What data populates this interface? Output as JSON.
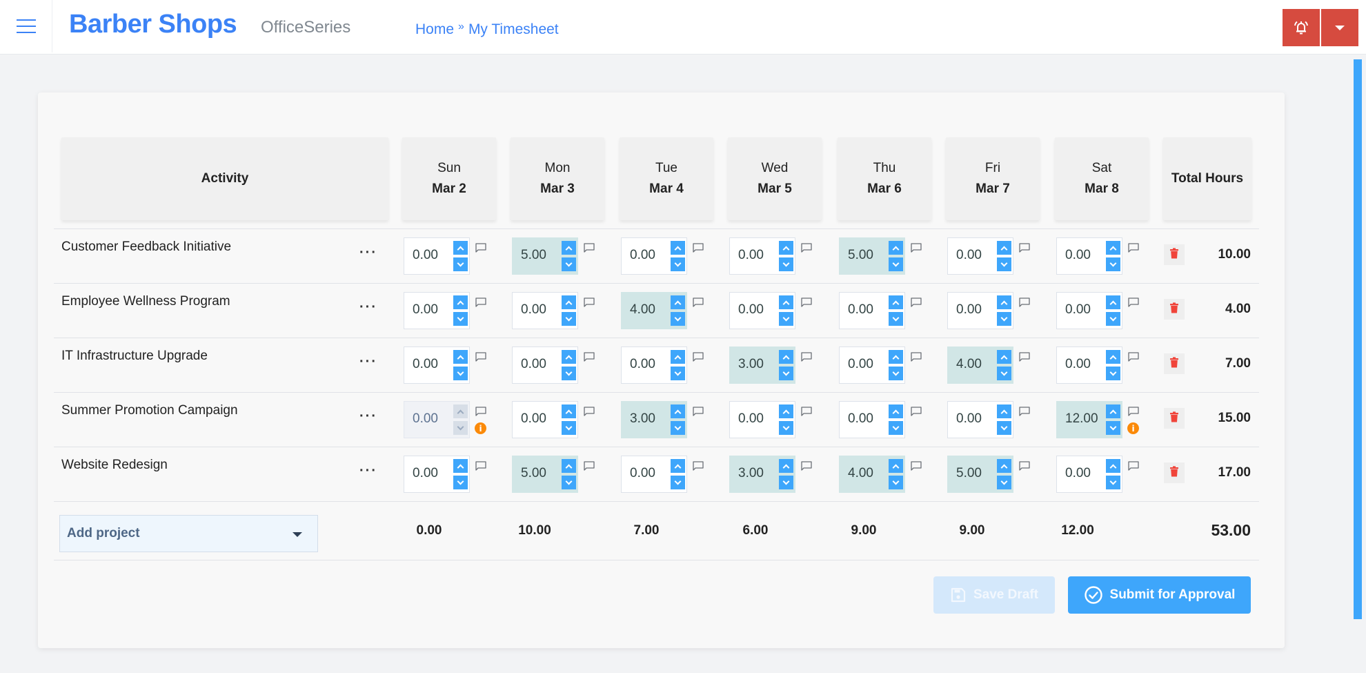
{
  "header": {
    "brand": "Barber Shops",
    "suite": "OfficeSeries",
    "breadcrumb": [
      {
        "label": "Home"
      },
      {
        "label": "My Timesheet"
      }
    ],
    "breadcrumb_separator": "»",
    "icons": {
      "menu": "hamburger-icon",
      "notifications": "bell-icon",
      "dropdown": "caret-down-icon"
    },
    "accent_color": "#3b82f6",
    "action_color": "#d64b3f"
  },
  "timesheet": {
    "activity_header": "Activity",
    "total_header": "Total Hours",
    "days": [
      {
        "day": "Sun",
        "date": "Mar 2"
      },
      {
        "day": "Mon",
        "date": "Mar 3"
      },
      {
        "day": "Tue",
        "date": "Mar 4"
      },
      {
        "day": "Wed",
        "date": "Mar 5"
      },
      {
        "day": "Thu",
        "date": "Mar 6"
      },
      {
        "day": "Fri",
        "date": "Mar 7"
      },
      {
        "day": "Sat",
        "date": "Mar 8"
      }
    ],
    "rows": [
      {
        "name": "Customer Feedback Initiative",
        "menu": "···",
        "hours": [
          "0.00",
          "5.00",
          "0.00",
          "0.00",
          "5.00",
          "0.00",
          "0.00"
        ],
        "total": "10.00",
        "disabled": [],
        "warnings": []
      },
      {
        "name": "Employee Wellness Program",
        "menu": "···",
        "hours": [
          "0.00",
          "0.00",
          "4.00",
          "0.00",
          "0.00",
          "0.00",
          "0.00"
        ],
        "total": "4.00",
        "disabled": [],
        "warnings": []
      },
      {
        "name": "IT Infrastructure Upgrade",
        "menu": "···",
        "hours": [
          "0.00",
          "0.00",
          "0.00",
          "3.00",
          "0.00",
          "4.00",
          "0.00"
        ],
        "total": "7.00",
        "disabled": [],
        "warnings": []
      },
      {
        "name": "Summer Promotion Campaign",
        "menu": "···",
        "hours": [
          "0.00",
          "0.00",
          "3.00",
          "0.00",
          "0.00",
          "0.00",
          "12.00"
        ],
        "total": "15.00",
        "disabled": [
          0
        ],
        "warnings": [
          0,
          6
        ]
      },
      {
        "name": "Website Redesign",
        "menu": "···",
        "hours": [
          "0.00",
          "5.00",
          "0.00",
          "3.00",
          "4.00",
          "5.00",
          "0.00"
        ],
        "total": "17.00",
        "disabled": [],
        "warnings": []
      }
    ],
    "add_project": {
      "label": "Add project"
    },
    "day_totals": [
      "0.00",
      "10.00",
      "7.00",
      "6.00",
      "9.00",
      "9.00",
      "12.00"
    ],
    "grand_total": "53.00",
    "filled_color": "#d1e6e6",
    "spinner_color": "#3ea6fb",
    "delete_color": "#f0443a",
    "warning_color": "#fb8a09",
    "warning_glyph": "i"
  },
  "actions": {
    "save_draft": {
      "label": "Save Draft",
      "disabled": true
    },
    "submit": {
      "label": "Submit for Approval"
    }
  }
}
